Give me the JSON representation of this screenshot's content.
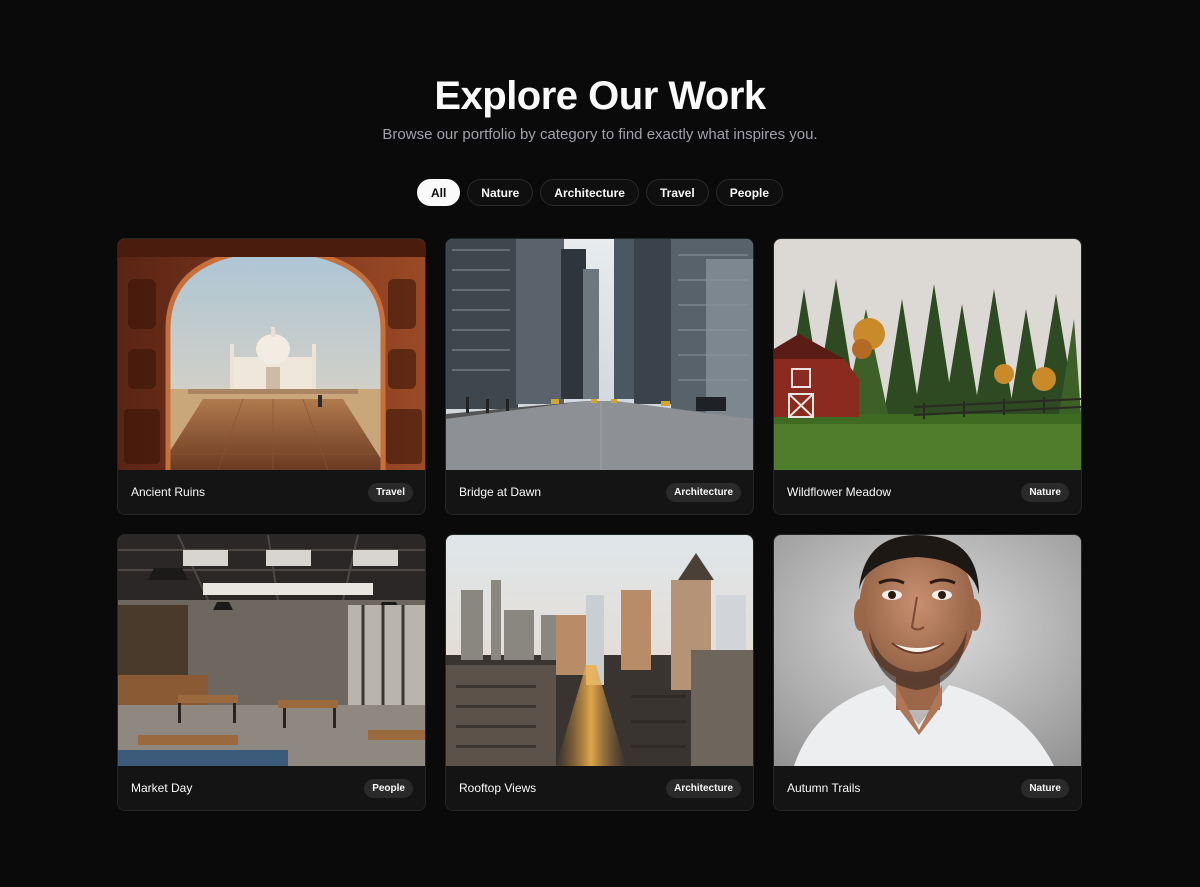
{
  "header": {
    "title": "Explore Our Work",
    "subtitle": "Browse our portfolio by category to find exactly what inspires you."
  },
  "filters": [
    {
      "label": "All",
      "active": true
    },
    {
      "label": "Nature",
      "active": false
    },
    {
      "label": "Architecture",
      "active": false
    },
    {
      "label": "Travel",
      "active": false
    },
    {
      "label": "People",
      "active": false
    }
  ],
  "cards": [
    {
      "title": "Ancient Ruins",
      "category": "Travel",
      "image": "taj-mahal-archway-photo"
    },
    {
      "title": "Bridge at Dawn",
      "category": "Architecture",
      "image": "city-street-skyscrapers-photo"
    },
    {
      "title": "Wildflower Meadow",
      "category": "Nature",
      "image": "red-barn-forest-photo"
    },
    {
      "title": "Market Day",
      "category": "People",
      "image": "industrial-cafe-interior-photo"
    },
    {
      "title": "Rooftop Views",
      "category": "Architecture",
      "image": "city-skyline-aerial-photo"
    },
    {
      "title": "Autumn Trails",
      "category": "Nature",
      "image": "smiling-man-portrait-photo"
    }
  ],
  "colors": {
    "background": "#0a0a0a",
    "card": "#141414",
    "badge": "#2a2a2a",
    "active_chip": "#fafafa"
  }
}
